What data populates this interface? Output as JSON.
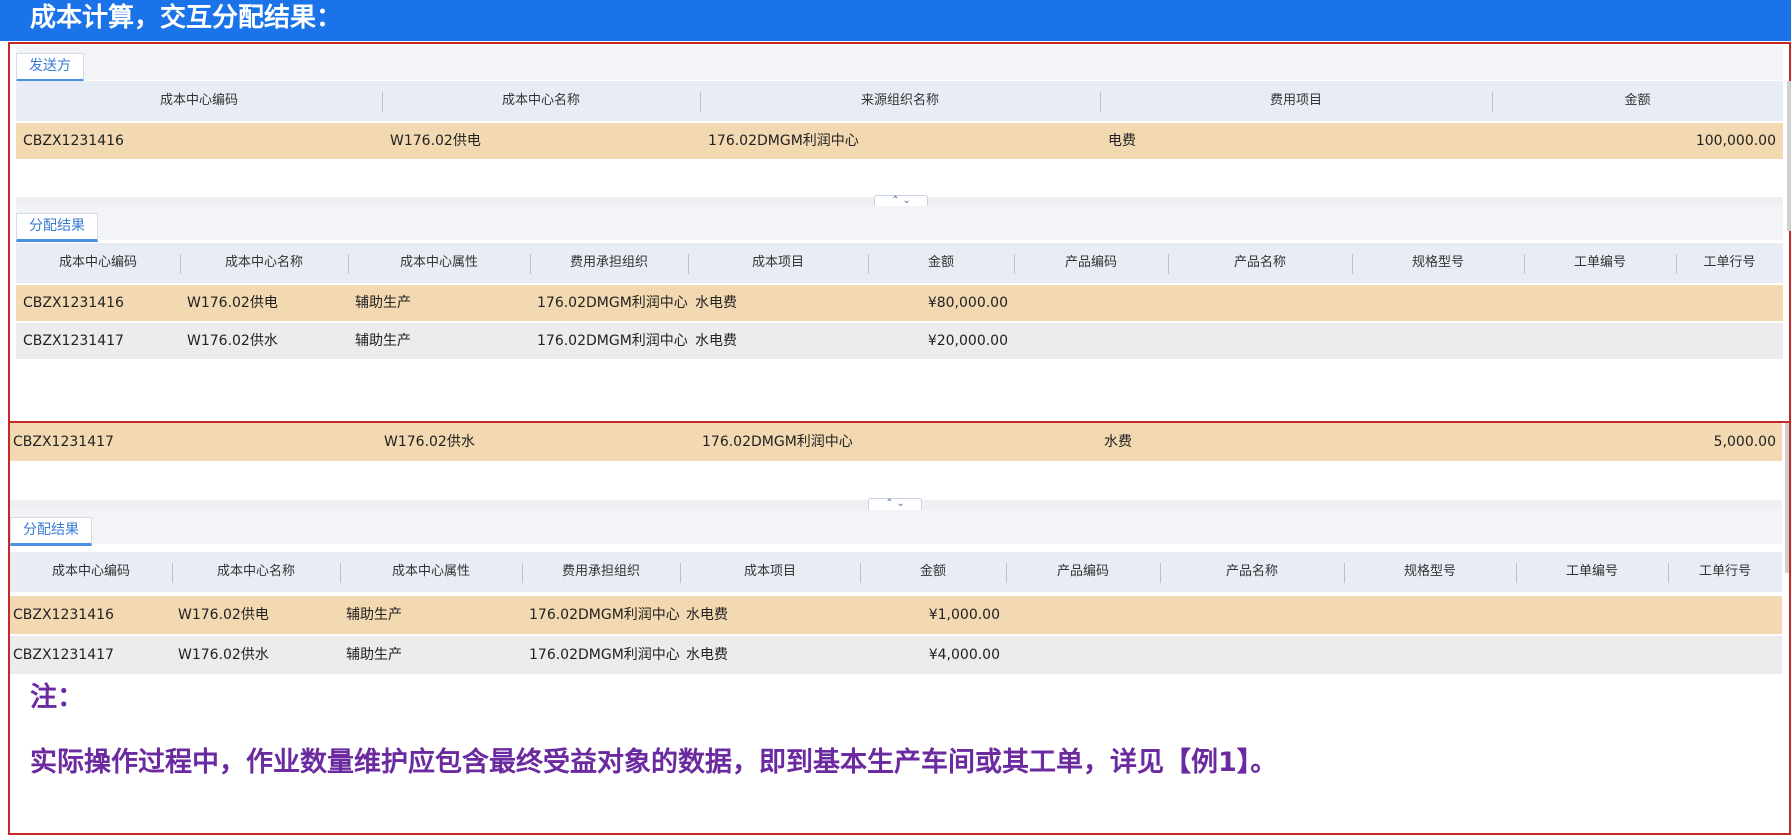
{
  "title": "成本计算，交互分配结果：",
  "panel1": {
    "sender_tab": "发送方",
    "sender_headers": [
      "成本中心编码",
      "成本中心名称",
      "来源组织名称",
      "费用项目",
      "金额"
    ],
    "sender_row": [
      "CBZX1231416",
      "W176.02供电",
      "176.02DMGM利润中心",
      "电费",
      "100,000.00"
    ],
    "result_tab": "分配结果",
    "result_headers": [
      "成本中心编码",
      "成本中心名称",
      "成本中心属性",
      "费用承担组织",
      "成本项目",
      "金额",
      "产品编码",
      "产品名称",
      "规格型号",
      "工单编号",
      "工单行号"
    ],
    "result_rows": [
      [
        "CBZX1231416",
        "W176.02供电",
        "辅助生产",
        "176.02DMGM利润中心",
        "水电费",
        "¥80,000.00"
      ],
      [
        "CBZX1231417",
        "W176.02供水",
        "辅助生产",
        "176.02DMGM利润中心",
        "水电费",
        "¥20,000.00"
      ]
    ],
    "splitter_label": "⌃ ⌄"
  },
  "panel2": {
    "sender_row": [
      "CBZX1231417",
      "W176.02供水",
      "176.02DMGM利润中心",
      "水费",
      "5,000.00"
    ],
    "result_tab": "分配结果",
    "result_headers": [
      "成本中心编码",
      "成本中心名称",
      "成本中心属性",
      "费用承担组织",
      "成本项目",
      "金额",
      "产品编码",
      "产品名称",
      "规格型号",
      "工单编号",
      "工单行号"
    ],
    "result_rows": [
      [
        "CBZX1231416",
        "W176.02供电",
        "辅助生产",
        "176.02DMGM利润中心",
        "水电费",
        "¥1,000.00"
      ],
      [
        "CBZX1231417",
        "W176.02供水",
        "辅助生产",
        "176.02DMGM利润中心",
        "水电费",
        "¥4,000.00"
      ]
    ],
    "splitter_label": "⌃ ⌄"
  },
  "note": {
    "label": "注：",
    "text": "实际操作过程中，作业数量维护应包含最终受益对象的数据，即到基本生产车间或其工单，详见【例1】。"
  },
  "colors": {
    "title_bar": "#1a73e8",
    "frame_border": "#c62828",
    "selected_row": "#f2d9b1",
    "alt_row": "#ececec",
    "note_text": "#6b2aa0"
  }
}
